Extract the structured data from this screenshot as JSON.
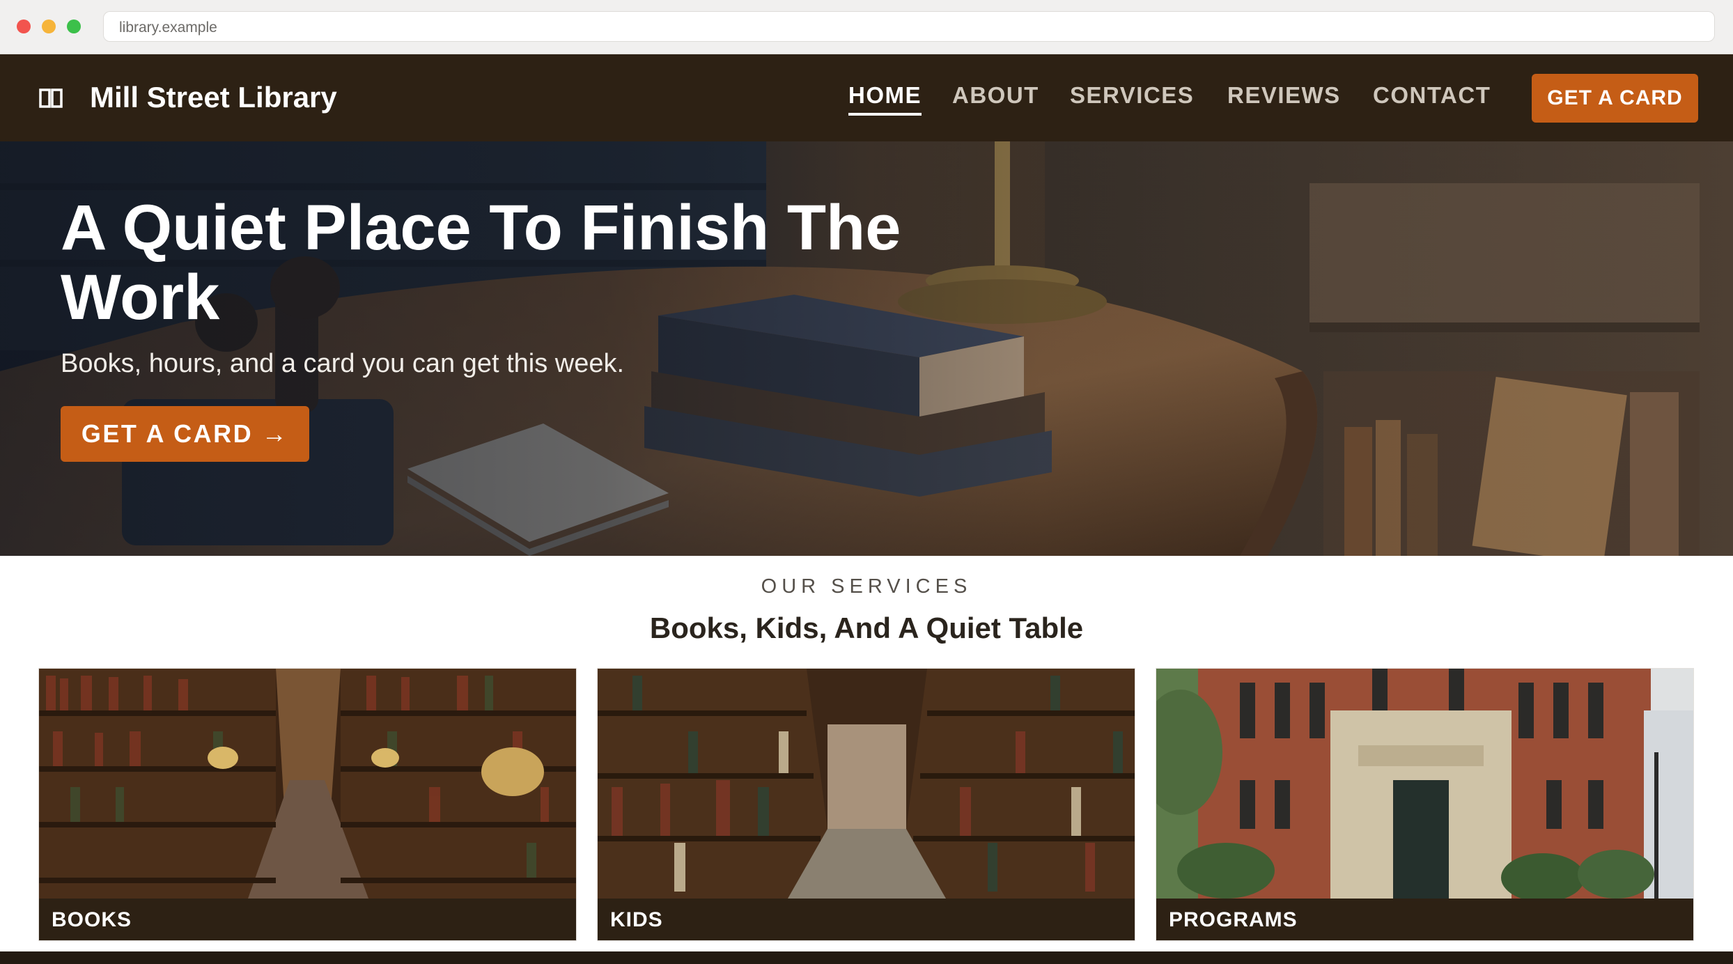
{
  "browser": {
    "url": "library.example"
  },
  "nav": {
    "brand": "Mill Street Library",
    "brand_icon": "open-book-icon",
    "links": [
      {
        "label": "HOME",
        "active": true
      },
      {
        "label": "ABOUT",
        "active": false
      },
      {
        "label": "SERVICES",
        "active": false
      },
      {
        "label": "REVIEWS",
        "active": false
      },
      {
        "label": "CONTACT",
        "active": false
      }
    ],
    "cta_label": "GET A CARD"
  },
  "hero": {
    "title": "A Quiet Place To Finish The Work",
    "subtitle": "Books, hours, and a card you can get this week.",
    "button_label": "GET A CARD →"
  },
  "services": {
    "eyebrow": "OUR SERVICES",
    "heading": "Books, Kids, And A Quiet Table",
    "cards": [
      {
        "label": "BOOKS"
      },
      {
        "label": "KIDS"
      },
      {
        "label": "PROGRAMS"
      }
    ]
  },
  "colors": {
    "nav_background": "#2d2114",
    "accent": "#c55d16",
    "text_dark": "#2a241d"
  }
}
